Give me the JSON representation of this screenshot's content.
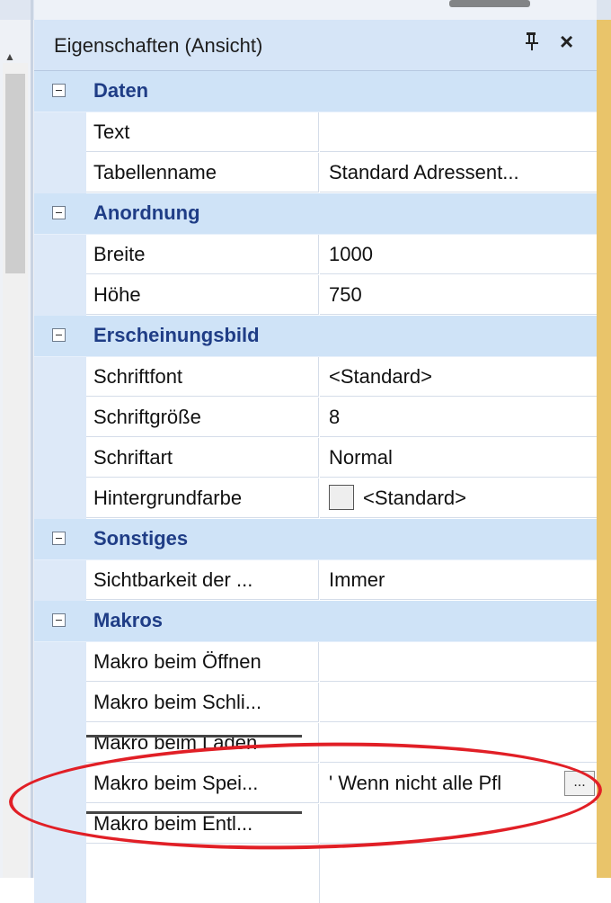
{
  "window": {
    "title": "Eigenschaften (Ansicht)",
    "pin_glyph": "pin-icon",
    "close_glyph": "×"
  },
  "left_panel": {
    "scroll_up_glyph": "▲"
  },
  "categories": [
    {
      "label": "Daten",
      "properties": [
        {
          "name": "Text",
          "value": ""
        },
        {
          "name": "Tabellenname",
          "value": "Standard Adressent..."
        }
      ]
    },
    {
      "label": "Anordnung",
      "properties": [
        {
          "name": "Breite",
          "value": "1000"
        },
        {
          "name": "Höhe",
          "value": "750"
        }
      ]
    },
    {
      "label": "Erscheinungsbild",
      "properties": [
        {
          "name": "Schriftfont",
          "value": "<Standard>"
        },
        {
          "name": "Schriftgröße",
          "value": "8"
        },
        {
          "name": "Schriftart",
          "value": "Normal"
        },
        {
          "name": "Hintergrundfarbe",
          "value": "<Standard>",
          "swatch_color": "#eeeeee"
        }
      ]
    },
    {
      "label": "Sonstiges",
      "properties": [
        {
          "name": "Sichtbarkeit der ...",
          "value": "Immer"
        }
      ]
    },
    {
      "label": "Makros",
      "properties": [
        {
          "name": "Makro beim Öffnen",
          "value": ""
        },
        {
          "name": "Makro beim Schli...",
          "value": ""
        },
        {
          "name": "Makro beim Laden",
          "value": ""
        },
        {
          "name": "Makro beim Spei...",
          "value": "' Wenn nicht alle Pfl",
          "button_label": "..."
        },
        {
          "name": "Makro beim Entl...",
          "value": ""
        }
      ]
    }
  ],
  "colors": {
    "category_text": "#1f3d86",
    "category_bg": "#cfe3f7",
    "annotation": "#e11f26",
    "accent_edge": "#e9c46a"
  }
}
